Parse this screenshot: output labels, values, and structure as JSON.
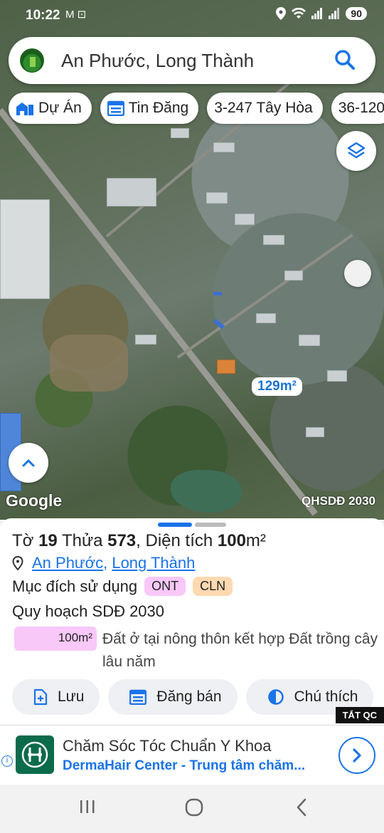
{
  "status_bar": {
    "time": "10:22",
    "left_icons": "M ⊡",
    "battery": "90"
  },
  "search": {
    "query": "An Phước, Long Thành"
  },
  "chips": [
    {
      "label": "Dự Án",
      "icon": "building-icon"
    },
    {
      "label": "Tin Đăng",
      "icon": "calendar-list-icon"
    },
    {
      "label": "3-247 Tây Hòa"
    },
    {
      "label": "36-120"
    }
  ],
  "map": {
    "area_label": "129m²",
    "google_label": "Google",
    "plan_label": "QHSDĐ 2030"
  },
  "parcel": {
    "to_label": "Tờ",
    "to_value": "19",
    "thua_label": "Thửa",
    "thua_value": "573",
    "dientich_label": ", Diện tích",
    "dientich_value": "100",
    "dientich_unit": "m²",
    "commune": "An Phước",
    "district": "Long Thành",
    "purpose_label": "Mục đích sử dụng",
    "tags": [
      "ONT",
      "CLN"
    ],
    "plan_title": "Quy hoạch SDĐ 2030",
    "legend_area": "100m²",
    "legend_text": "Đất ở tại nông thôn kết hợp Đất trồng cây lâu năm"
  },
  "actions": [
    {
      "label": "Lưu"
    },
    {
      "label": "Đăng bán"
    },
    {
      "label": "Chú thích"
    }
  ],
  "ad": {
    "tag": "TẮT QC",
    "title": "Chăm Sóc Tóc Chuẩn Y Khoa",
    "subtitle": "DermaHair Center - Trung tâm chăm..."
  },
  "colors": {
    "accent": "#1a73e8",
    "ont": "#f8c8f8",
    "cln": "#ffd9b0"
  }
}
